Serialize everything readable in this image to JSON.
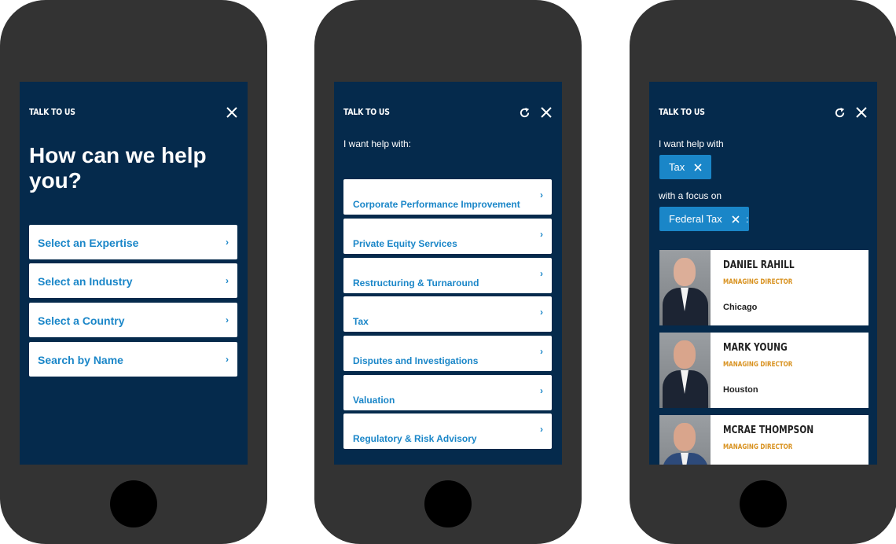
{
  "colors": {
    "background": "#052a4c",
    "accent": "#1a86c8",
    "title_gold": "#d8911e",
    "phone": "#333333"
  },
  "screen1": {
    "header": "TALK TO US",
    "heading": "How can we help you?",
    "options": [
      {
        "label": "Select an Expertise"
      },
      {
        "label": "Select an Industry"
      },
      {
        "label": "Select a Country"
      },
      {
        "label": "Search by Name"
      }
    ],
    "chevron": "›"
  },
  "screen2": {
    "header": "TALK TO US",
    "prompt": "I want help with:",
    "options": [
      {
        "label": "Corporate Performance Improvement"
      },
      {
        "label": "Private Equity Services"
      },
      {
        "label": "Restructuring & Turnaround"
      },
      {
        "label": "Tax"
      },
      {
        "label": "Disputes and Investigations"
      },
      {
        "label": "Valuation"
      },
      {
        "label": "Regulatory & Risk Advisory"
      }
    ],
    "chevron": "›"
  },
  "screen3": {
    "header": "TALK TO US",
    "prompt": "I want help with",
    "chip1": "Tax",
    "focus": "with a focus on",
    "chip2": "Federal Tax",
    "colon": ":",
    "people": [
      {
        "name": "DANIEL RAHILL",
        "title": "MANAGING DIRECTOR",
        "city": "Chicago"
      },
      {
        "name": "MARK YOUNG",
        "title": "MANAGING DIRECTOR",
        "city": "Houston"
      },
      {
        "name": "MCRAE THOMPSON",
        "title": "MANAGING DIRECTOR",
        "city": ""
      }
    ]
  }
}
